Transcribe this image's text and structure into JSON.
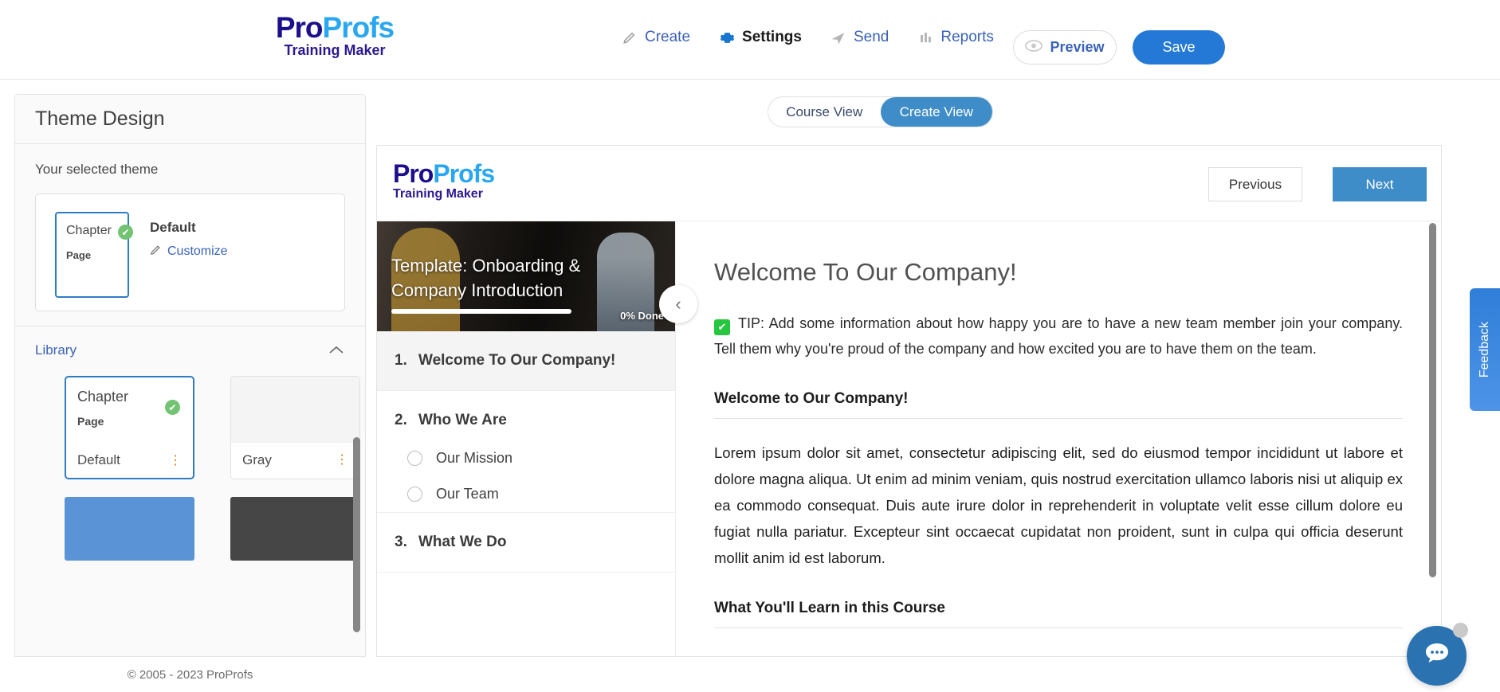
{
  "brand": {
    "logo_part1": "Pro",
    "logo_part2": "Profs",
    "logo_tagline": "Training Maker",
    "color_dark": "#1c0f8c",
    "color_light": "#2aa7f0",
    "accent_blue": "#2479d6"
  },
  "topnav": {
    "items": [
      {
        "label": "Create",
        "icon": "pencil-icon",
        "active": false
      },
      {
        "label": "Settings",
        "icon": "gear-icon",
        "active": true
      },
      {
        "label": "Send",
        "icon": "paper-plane-icon",
        "active": false
      },
      {
        "label": "Reports",
        "icon": "bar-chart-icon",
        "active": false
      }
    ],
    "preview_label": "Preview",
    "save_label": "Save"
  },
  "sidebar": {
    "title": "Theme Design",
    "selected_theme_label": "Your selected theme",
    "selected_theme": {
      "thumb_chapter": "Chapter",
      "thumb_page": "Page",
      "name": "Default",
      "customize_label": "Customize",
      "check_icon": "check-circle-icon",
      "pencil_icon": "pencil-icon"
    },
    "library": {
      "title": "Library",
      "collapse_icon": "chevron-up-icon",
      "cards": [
        {
          "chapter": "Chapter",
          "page": "Page",
          "name": "Default",
          "selected": true,
          "menu_icon": "kebab-menu-icon"
        },
        {
          "chapter": "",
          "page": "",
          "name": "Gray",
          "selected": false,
          "menu_icon": "kebab-menu-icon"
        }
      ],
      "swatches": [
        {
          "name": "blue-swatch",
          "color": "#5b94d6"
        },
        {
          "name": "dark-swatch",
          "color": "#464646"
        }
      ]
    }
  },
  "footer": {
    "copyright": "© 2005 - 2023 ProProfs"
  },
  "view_toggle": {
    "options": [
      {
        "label": "Course View",
        "active": false
      },
      {
        "label": "Create View",
        "active": true
      }
    ]
  },
  "preview": {
    "prev_label": "Previous",
    "next_label": "Next",
    "hero": {
      "title": "Template: Onboarding & Company Introduction",
      "progress_label": "0% Done",
      "progress_percent": 0,
      "collapse_icon": "chevron-left-icon"
    },
    "outline": [
      {
        "num": "1.",
        "label": "Welcome To Our Company!",
        "active": true,
        "subitems": []
      },
      {
        "num": "2.",
        "label": "Who We Are",
        "active": false,
        "subitems": [
          {
            "label": "Our Mission",
            "icon": "radio-circle-icon"
          },
          {
            "label": "Our Team",
            "icon": "radio-circle-icon"
          }
        ]
      },
      {
        "num": "3.",
        "label": "What We Do",
        "active": false,
        "subitems": []
      }
    ],
    "article": {
      "title": "Welcome To Our Company!",
      "tip_icon": "green-check-icon",
      "tip": "TIP: Add some information about how happy you are to have a new team member join your company. Tell them why you're proud of the company and how excited you are to have them on the team.",
      "heading1": "Welcome to Our Company!",
      "paragraph1": "Lorem ipsum dolor sit amet, consectetur adipiscing elit, sed do eiusmod tempor incididunt ut labore et dolore magna aliqua. Ut enim ad minim veniam, quis nostrud exercitation ullamco laboris nisi ut aliquip ex ea commodo consequat. Duis aute irure dolor in reprehenderit in voluptate velit esse cillum dolore eu fugiat nulla pariatur. Excepteur sint occaecat cupidatat non proident, sunt in culpa qui officia deserunt mollit anim id est laborum.",
      "heading2": "What You'll Learn in this Course"
    }
  },
  "widgets": {
    "feedback_label": "Feedback",
    "chat_icon": "chat-bubble-icon"
  }
}
